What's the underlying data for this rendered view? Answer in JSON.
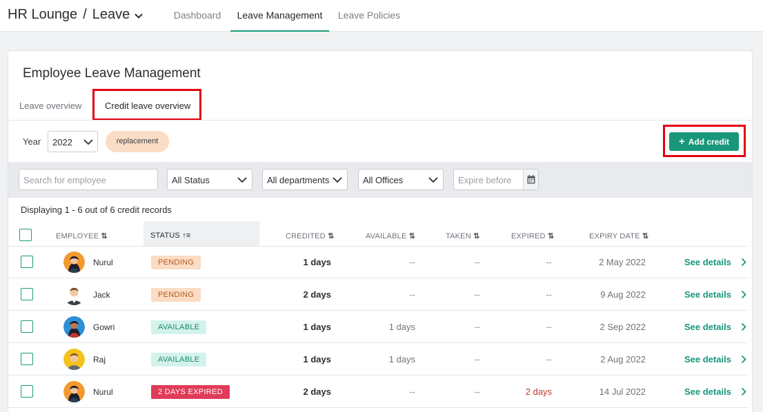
{
  "header": {
    "brand": "HR Lounge",
    "separator": "/",
    "module": "Leave",
    "tabs": [
      {
        "label": "Dashboard",
        "active": false
      },
      {
        "label": "Leave Management",
        "active": true
      },
      {
        "label": "Leave Policies",
        "active": false
      }
    ]
  },
  "card": {
    "title": "Employee Leave Management",
    "subtabs": [
      {
        "label": "Leave overview",
        "active": false
      },
      {
        "label": "Credit leave overview",
        "active": true
      }
    ]
  },
  "controls": {
    "year_label": "Year",
    "year_value": "2022",
    "chip_label": "replacement",
    "add_credit_label": "Add credit",
    "search_placeholder": "Search for employee",
    "status_value": "All Status",
    "departments_value": "All departments",
    "offices_value": "All Offices",
    "expire_placeholder": "Expire before"
  },
  "summary": "Displaying 1 - 6 out of 6 credit records",
  "table": {
    "headers": {
      "employee": "EMPLOYEE",
      "status": "STATUS",
      "credited": "CREDITED",
      "available": "AVAILABLE",
      "taken": "TAKEN",
      "expired": "EXPIRED",
      "expiry_date": "EXPIRY DATE"
    },
    "link_label": "See details",
    "rows": [
      {
        "name": "Nurul",
        "status": "PENDING",
        "credited": "1 days",
        "available": "--",
        "taken": "--",
        "expired": "--",
        "expiry": "2 May 2022"
      },
      {
        "name": "Jack",
        "status": "PENDING",
        "credited": "2 days",
        "available": "--",
        "taken": "--",
        "expired": "--",
        "expiry": "9 Aug 2022"
      },
      {
        "name": "Gowri",
        "status": "AVAILABLE",
        "credited": "1 days",
        "available": "1 days",
        "taken": "--",
        "expired": "--",
        "expiry": "2 Sep 2022"
      },
      {
        "name": "Raj",
        "status": "AVAILABLE",
        "credited": "1 days",
        "available": "1 days",
        "taken": "--",
        "expired": "--",
        "expiry": "2 Aug 2022"
      },
      {
        "name": "Nurul",
        "status": "2 DAYS EXPIRED",
        "credited": "2 days",
        "available": "--",
        "taken": "--",
        "expired": "2 days",
        "expiry": "14 Jul 2022"
      }
    ]
  },
  "colors": {
    "accent": "#18977a",
    "highlight": "#e4000f",
    "pending_bg": "#fbdcc4",
    "available_bg": "#d3f2ec",
    "expired_bg": "#e03b57"
  }
}
